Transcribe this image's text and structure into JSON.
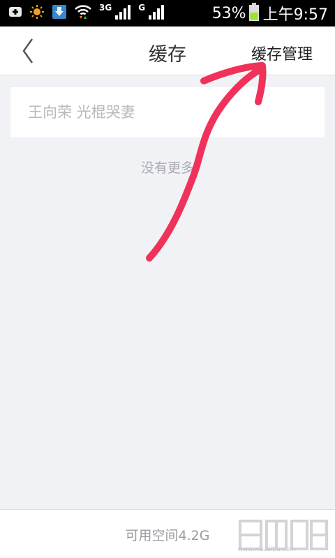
{
  "status_bar": {
    "network_type_1": "3G",
    "network_type_2": "G",
    "battery_percent": "53%",
    "time": "上午9:57",
    "battery_color": "#9be22d"
  },
  "header": {
    "back_icon": "chevron-left-icon",
    "title": "缓存",
    "manage_label": "缓存管理"
  },
  "cache_list": {
    "items": [
      {
        "title": "王向荣 光棍哭妻"
      }
    ],
    "end_text": "没有更多"
  },
  "footer": {
    "storage_text": "可用空间4.2G",
    "watermark_url": "www.xiazaiba.com"
  },
  "annotation": {
    "color": "#f0325a"
  }
}
